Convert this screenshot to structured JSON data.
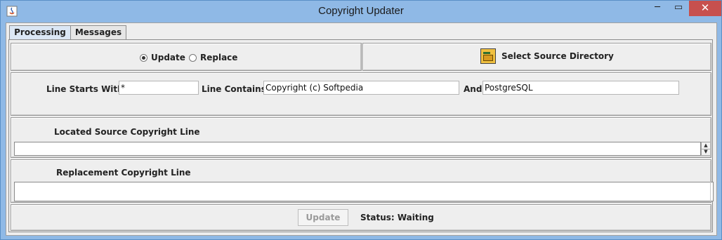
{
  "window": {
    "title": "Copyright Updater",
    "minimize_glyph": "─",
    "maximize_glyph": "▭",
    "close_glyph": "✕"
  },
  "tabs": [
    {
      "label": "Processing",
      "active": true
    },
    {
      "label": "Messages",
      "active": false
    }
  ],
  "mode": {
    "options": [
      {
        "label": "Update",
        "selected": true
      },
      {
        "label": "Replace",
        "selected": false
      }
    ]
  },
  "source_dir": {
    "button_label": "Select Source Directory",
    "icon": "folder-open-icon"
  },
  "filter": {
    "line_starts_label": "Line Starts With:",
    "line_starts_value": "*",
    "line_contains_label": "Line Contains:",
    "line_contains_value": "Copyright (c) Softpedia",
    "and_label": "And",
    "and_value": "PostgreSQL"
  },
  "located": {
    "label": "Located Source Copyright Line",
    "value": ""
  },
  "replacement": {
    "label": "Replacement Copyright Line",
    "value": ""
  },
  "footer": {
    "update_button": "Update",
    "status_text": "Status: Waiting"
  },
  "colors": {
    "title_bar": "#8fb9e6",
    "close_button": "#c7504e",
    "panel_bg": "#eeeeee"
  }
}
